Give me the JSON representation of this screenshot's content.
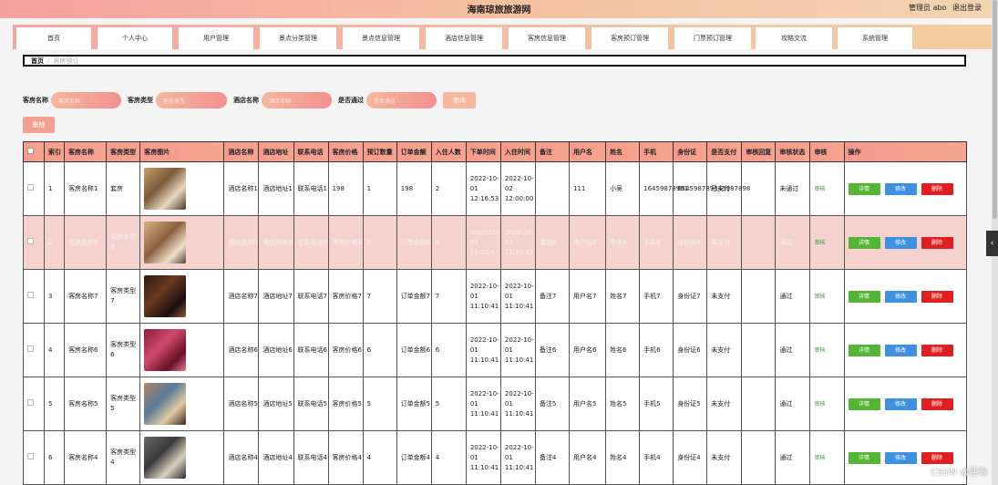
{
  "header": {
    "title": "海南琼旅旅游网",
    "admin": "管理员 abo",
    "logout": "退出登录"
  },
  "nav": [
    "首页",
    "个人中心",
    "用户管理",
    "景点分类管理",
    "景点信息管理",
    "酒店信息管理",
    "客房信息管理",
    "客房预订管理",
    "门票预订管理",
    "攻略交流",
    "系统管理"
  ],
  "breadcrumb": {
    "home": "首页",
    "sep": "/",
    "current": "客房预订"
  },
  "search": {
    "room_name_label": "客房名称",
    "room_name_placeholder": "客房名称",
    "room_type_label": "客房类型",
    "room_type_placeholder": "客房类型",
    "hotel_name_label": "酒店名称",
    "hotel_name_placeholder": "酒店名称",
    "passed_label": "是否通过",
    "passed_placeholder": "是否通过",
    "search_button": "查询"
  },
  "delete_button": "删除",
  "table": {
    "headers": [
      "",
      "索引",
      "客房名称",
      "客房类型",
      "客房图片",
      "酒店名称",
      "酒店地址",
      "联系电话",
      "客房价格",
      "预订数量",
      "订单金额",
      "入住人数",
      "下单时间",
      "入住时间",
      "备注",
      "用户名",
      "姓名",
      "手机",
      "身份证",
      "是否支付",
      "审核回复",
      "审核状态",
      "审核",
      "操作"
    ],
    "actions": {
      "detail": "详情",
      "edit": "修改",
      "delete": "删除"
    },
    "audit_link": "审核",
    "rows": [
      {
        "idx": "1",
        "room": "客房名称1",
        "type": "套房",
        "hotel": "酒店名称1",
        "addr": "酒店地址1",
        "phone": "联系电话1",
        "price": "198",
        "qty": "1",
        "amount": "198",
        "guests": "2",
        "order_time": "2022-10-01 12:16:53",
        "checkin": "2022-10-02 12:00:00",
        "note": "",
        "user": "111",
        "name": "小吴",
        "mobile": "16459878981",
        "idcard": "654598789845987898",
        "paid": "已支付",
        "reply": "",
        "status": "未通过"
      },
      {
        "idx": "2",
        "room": "客房名称8",
        "type": "客房类型8",
        "hotel": "酒店名称8",
        "addr": "酒店地址8",
        "phone": "联系电话8",
        "price": "客房价格8",
        "qty": "8",
        "amount": "订单金额8",
        "guests": "8",
        "order_time": "2022-10-01 11:10:41",
        "checkin": "2022-10-01 11:10:41",
        "note": "备注8",
        "user": "用户名8",
        "name": "姓名8",
        "mobile": "手机8",
        "idcard": "身份证8",
        "paid": "未支付",
        "reply": "",
        "status": "通过"
      },
      {
        "idx": "3",
        "room": "客房名称7",
        "type": "客房类型7",
        "hotel": "酒店名称7",
        "addr": "酒店地址7",
        "phone": "联系电话7",
        "price": "客房价格7",
        "qty": "7",
        "amount": "订单金额7",
        "guests": "7",
        "order_time": "2022-10-01 11:10:41",
        "checkin": "2022-10-01 11:10:41",
        "note": "备注7",
        "user": "用户名7",
        "name": "姓名7",
        "mobile": "手机7",
        "idcard": "身份证7",
        "paid": "未支付",
        "reply": "",
        "status": "通过"
      },
      {
        "idx": "4",
        "room": "客房名称6",
        "type": "客房类型6",
        "hotel": "酒店名称6",
        "addr": "酒店地址6",
        "phone": "联系电话6",
        "price": "客房价格6",
        "qty": "6",
        "amount": "订单金额6",
        "guests": "6",
        "order_time": "2022-10-01 11:10:41",
        "checkin": "2022-10-01 11:10:41",
        "note": "备注6",
        "user": "用户名6",
        "name": "姓名6",
        "mobile": "手机6",
        "idcard": "身份证6",
        "paid": "未支付",
        "reply": "",
        "status": "通过"
      },
      {
        "idx": "5",
        "room": "客房名称5",
        "type": "客房类型5",
        "hotel": "酒店名称5",
        "addr": "酒店地址5",
        "phone": "联系电话5",
        "price": "客房价格5",
        "qty": "5",
        "amount": "订单金额5",
        "guests": "5",
        "order_time": "2022-10-01 11:10:41",
        "checkin": "2022-10-01 11:10:41",
        "note": "备注5",
        "user": "用户名5",
        "name": "姓名5",
        "mobile": "手机5",
        "idcard": "身份证5",
        "paid": "未支付",
        "reply": "",
        "status": "通过"
      },
      {
        "idx": "6",
        "room": "客房名称4",
        "type": "客房类型4",
        "hotel": "酒店名称4",
        "addr": "酒店地址4",
        "phone": "联系电话4",
        "price": "客房价格4",
        "qty": "4",
        "amount": "订单金额4",
        "guests": "4",
        "order_time": "2022-10-01 11:10:41",
        "checkin": "2022-10-01 11:10:41",
        "note": "备注4",
        "user": "用户名4",
        "name": "姓名4",
        "mobile": "手机4",
        "idcard": "身份证4",
        "paid": "未支付",
        "reply": "",
        "status": "通过"
      }
    ]
  },
  "watermark": "CSDN @佳瑜",
  "colors": {
    "accent": "#f5a58f",
    "detail": "#53b533",
    "edit": "#3e91e0",
    "delete": "#e02020"
  }
}
